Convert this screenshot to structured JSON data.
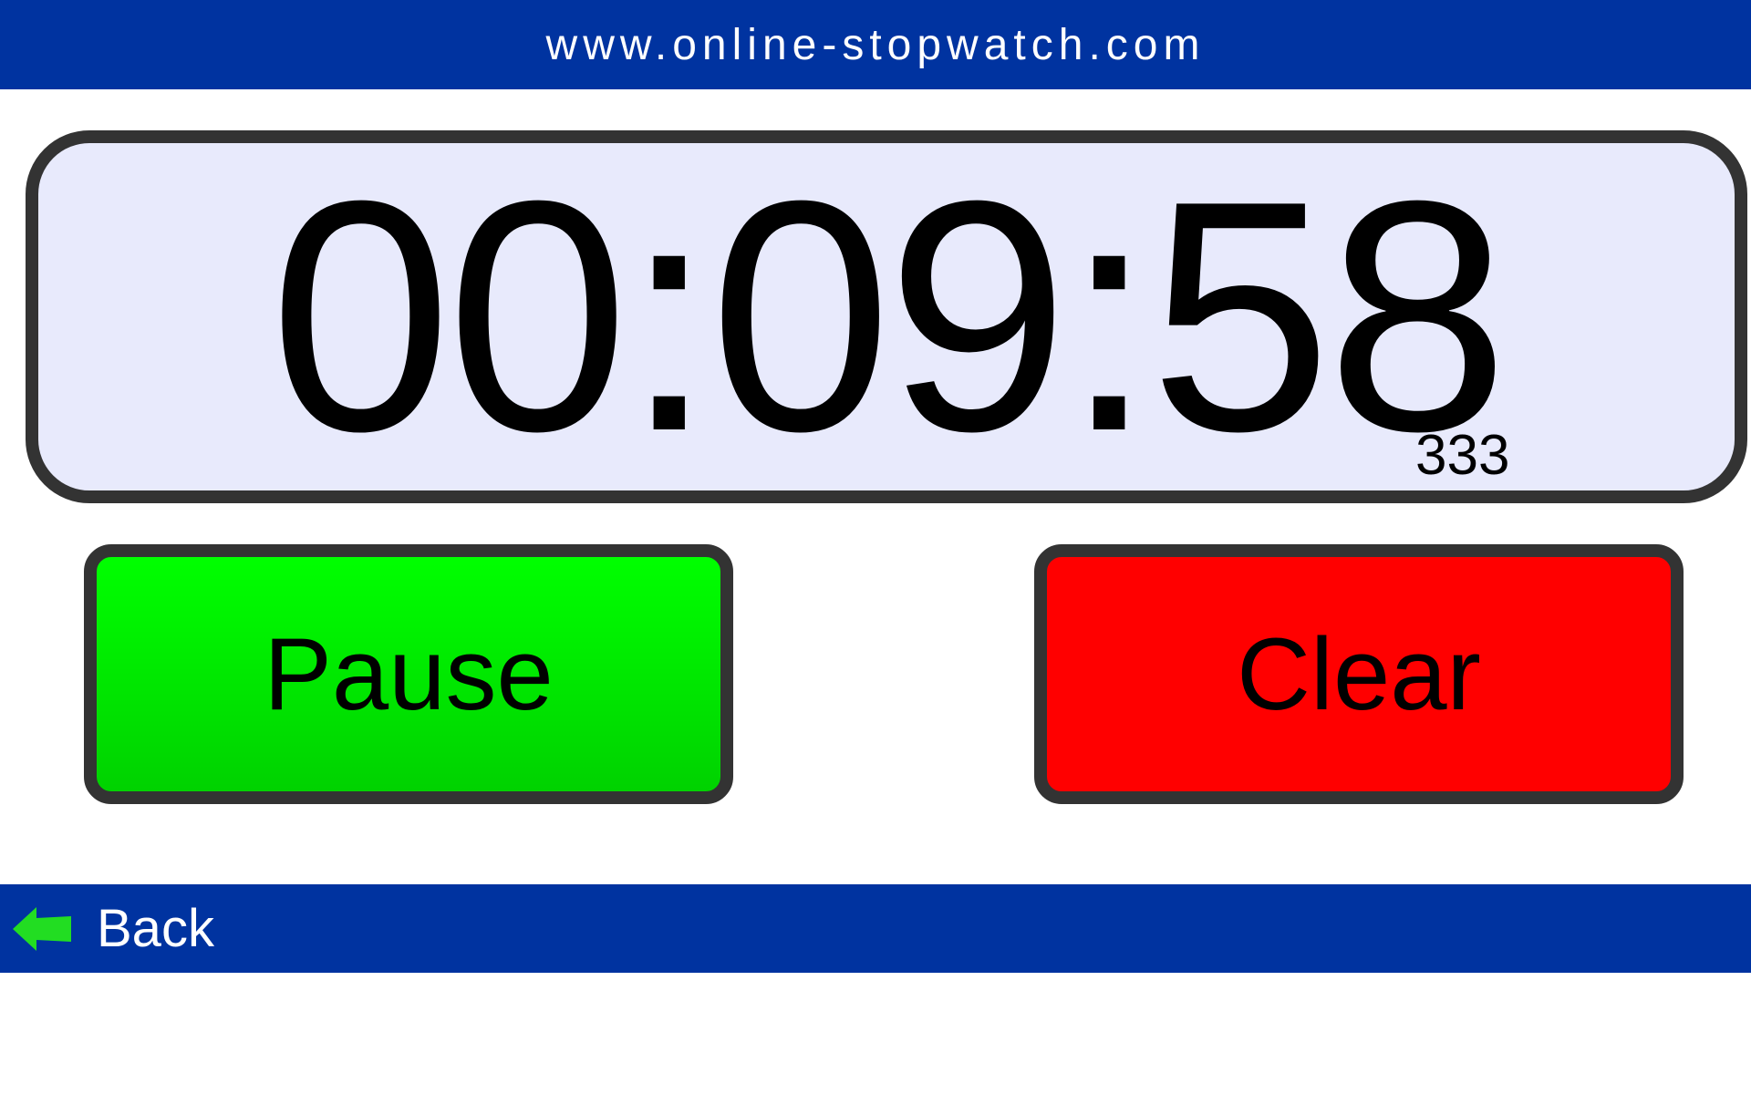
{
  "header": {
    "site_title": "www.online-stopwatch.com"
  },
  "stopwatch": {
    "time": "00:09:58",
    "milliseconds": "333"
  },
  "controls": {
    "pause_label": "Pause",
    "clear_label": "Clear"
  },
  "footer": {
    "back_label": "Back",
    "back_icon": "back-arrow-icon"
  },
  "colors": {
    "bar_blue": "#0033a0",
    "pause_green": "#00ff00",
    "clear_red": "#ff0000",
    "display_bg": "#e8eafc",
    "border": "#333333",
    "back_arrow_green": "#22dd22"
  }
}
